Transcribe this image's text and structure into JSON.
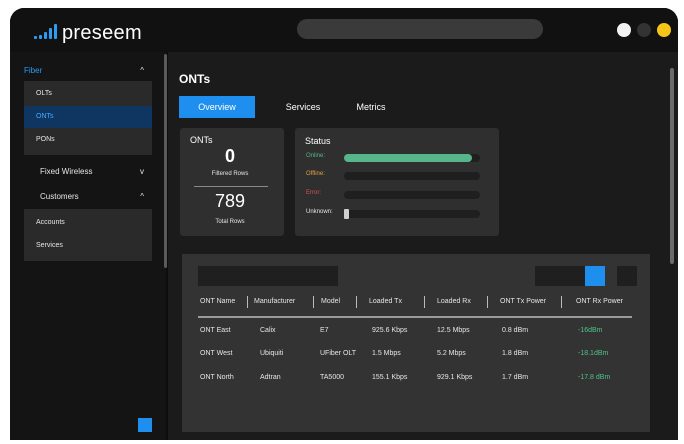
{
  "app": {
    "logo_text": "preseem",
    "colors": {
      "accent": "#1e8fef",
      "online": "#56b68a",
      "offline": "#e0a040",
      "error": "#d9534f"
    }
  },
  "window_controls": [
    {
      "name": "white-dot",
      "color": "#f2f2f2"
    },
    {
      "name": "dark-dot",
      "color": "#333333"
    },
    {
      "name": "yellow-dot",
      "color": "#f5c518"
    }
  ],
  "sidebar": {
    "fiber": {
      "label": "Fiber",
      "chevron": "^",
      "items": [
        {
          "label": "OLTs",
          "active": false
        },
        {
          "label": "ONTs",
          "active": true
        },
        {
          "label": "PONs",
          "active": false
        }
      ]
    },
    "fixed_wireless": {
      "label": "Fixed Wireless",
      "chevron": "v"
    },
    "customers": {
      "label": "Customers",
      "chevron": "^",
      "items": [
        {
          "label": "Accounts"
        },
        {
          "label": "Services"
        }
      ]
    }
  },
  "main": {
    "title": "ONTs",
    "tabs": [
      {
        "label": "Overview",
        "active": true
      },
      {
        "label": "Services",
        "active": false
      },
      {
        "label": "Metrics",
        "active": false
      }
    ],
    "onts_card": {
      "title": "ONTs",
      "filtered_value": "0",
      "filtered_label": "Filtered Rows",
      "total_value": "789",
      "total_label": "Total Rows"
    },
    "status_card": {
      "title": "Status",
      "rows": [
        {
          "label": "Online:",
          "fraction": 0.94,
          "color": "#56b68a"
        },
        {
          "label": "Offline:",
          "fraction": 0.0,
          "color": "#e0a040"
        },
        {
          "label": "Error:",
          "fraction": 0.0,
          "color": "#d9534f"
        },
        {
          "label": "Unknown:",
          "fraction": 0.04,
          "color": "#cfcfcf"
        }
      ]
    },
    "table": {
      "columns": [
        "ONT Name",
        "Manufacturer",
        "Model",
        "Loaded Tx",
        "Loaded Rx",
        "ONT Tx Power",
        "ONT Rx Power"
      ],
      "rows": [
        [
          "ONT East",
          "Calix",
          "E7",
          "925.6 Kbps",
          "12.5 Mbps",
          "0.8 dBm",
          "-16dBm"
        ],
        [
          "ONT West",
          "Ubiquiti",
          "UFiber OLT",
          "1.5 Mbps",
          "5.2 Mbps",
          "1.8 dBm",
          "-18.1dBm"
        ],
        [
          "ONT North",
          "Adtran",
          "TA5000",
          "155.1 Kbps",
          "929.1 Kbps",
          "1.7 dBm",
          "-17.8 dBm"
        ]
      ]
    }
  }
}
